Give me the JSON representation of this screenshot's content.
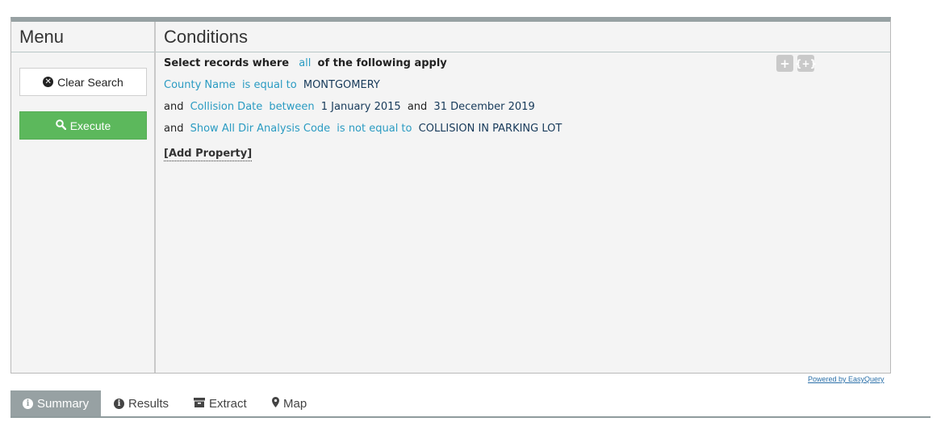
{
  "menu": {
    "title": "Menu",
    "clear_label": "Clear Search",
    "execute_label": "Execute"
  },
  "conditions": {
    "title": "Conditions",
    "header": {
      "prefix": "Select records where",
      "quantifier": "all",
      "suffix": "of the following apply"
    },
    "rows": [
      {
        "conj": "",
        "field": "County Name",
        "op": "is equal to",
        "value1": "MONTGOMERY"
      },
      {
        "conj": "and",
        "field": "Collision Date",
        "op": "between",
        "value1": "1 January 2015",
        "mid": "and",
        "value2": "31 December 2019"
      },
      {
        "conj": "and",
        "field": "Show All Dir Analysis Code",
        "op": "is not equal to",
        "value1": "COLLISION IN PARKING LOT"
      }
    ],
    "add_property": "[Add Property]",
    "controls": {
      "add_condition": "+",
      "add_group": "{+}"
    }
  },
  "powered_by": "Powered by EasyQuery",
  "tabs": [
    {
      "label": "Summary",
      "icon": "info-icon",
      "active": true
    },
    {
      "label": "Results",
      "icon": "info-icon",
      "active": false
    },
    {
      "label": "Extract",
      "icon": "archive-icon",
      "active": false
    },
    {
      "label": "Map",
      "icon": "map-marker-icon",
      "active": false
    }
  ],
  "colors": {
    "execute": "#5cb85c",
    "link": "#2a9bc2",
    "tab_active": "#97a1a3"
  }
}
